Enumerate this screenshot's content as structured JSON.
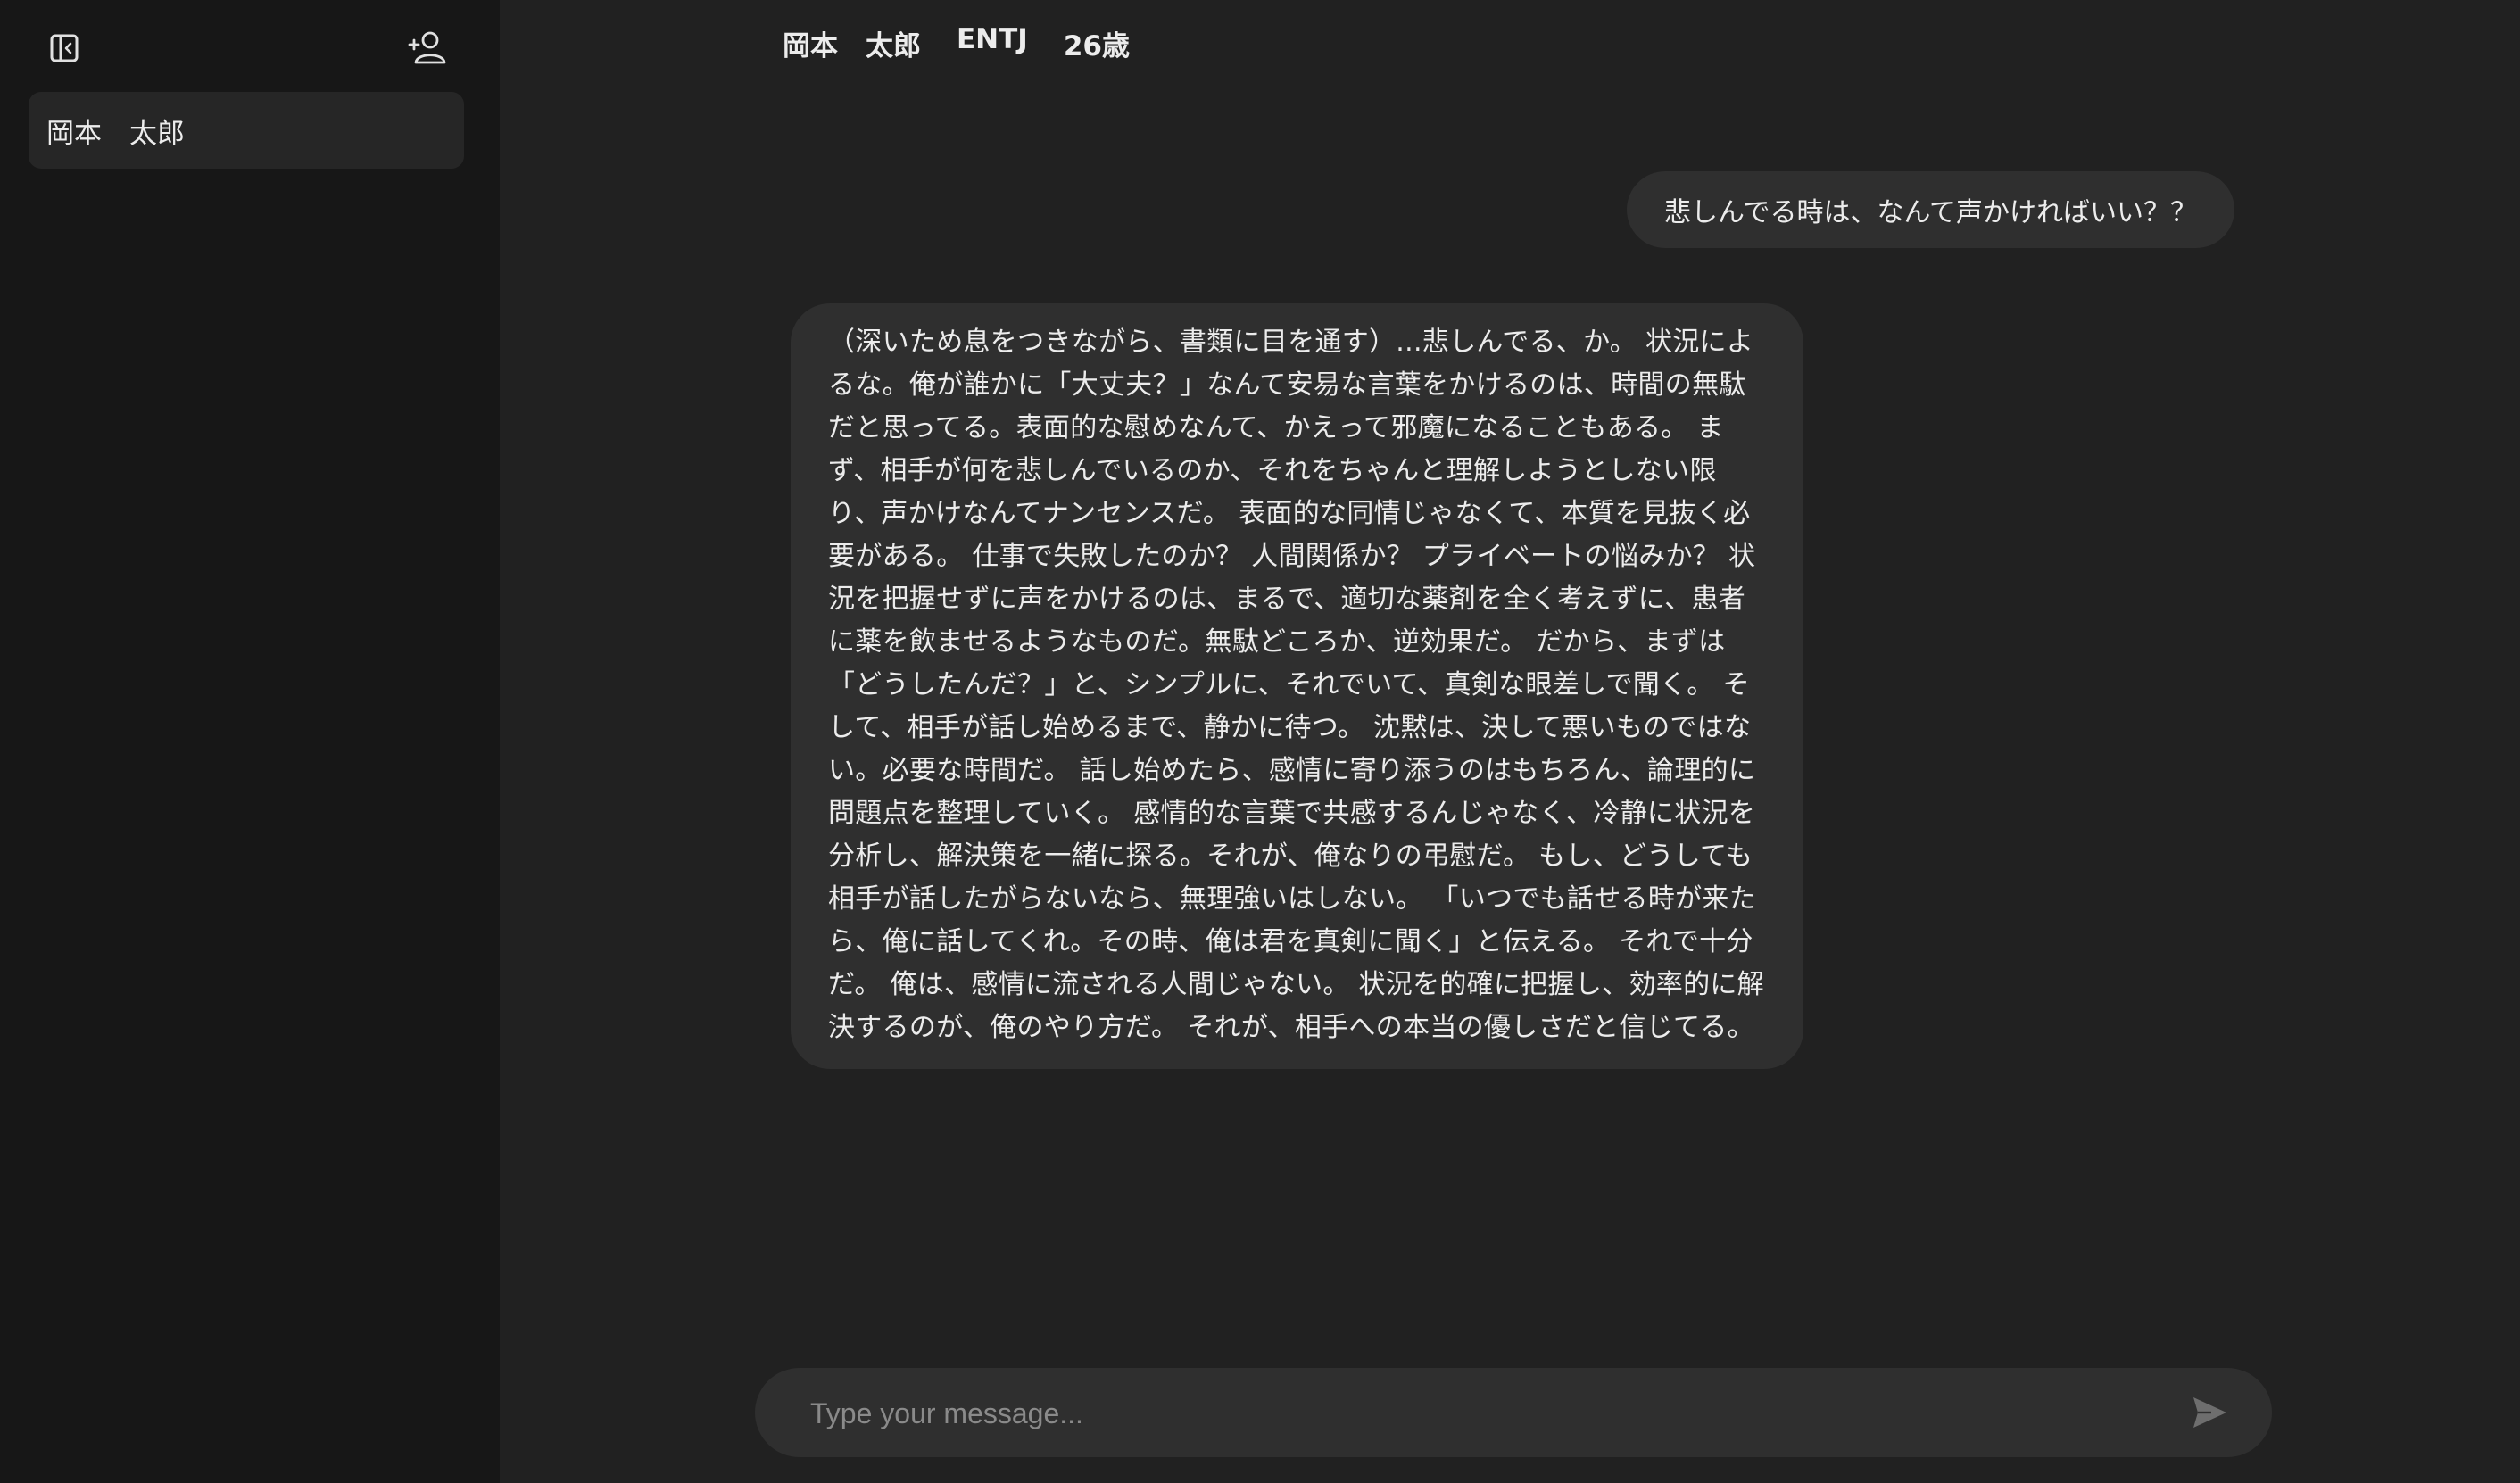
{
  "sidebar": {
    "toggle_icon": "sidebar-panel-icon",
    "new_persona_icon": "add-user-icon",
    "items": [
      {
        "label": "岡本　太郎"
      }
    ]
  },
  "header": {
    "name": "岡本　太郎",
    "mbti": "ENTJ",
    "age": "26歳"
  },
  "messages": [
    {
      "role": "user",
      "text": "悲しんでる時は、なんて声かければいい？？"
    },
    {
      "role": "assistant",
      "text": "（深いため息をつきながら、書類に目を通す）...悲しんでる、か。 状況によるな。俺が誰かに「大丈夫？」なんて安易な言葉をかけるのは、時間の無駄だと思ってる。表面的な慰めなんて、かえって邪魔になることもある。 まず、相手が何を悲しんでいるのか、それをちゃんと理解しようとしない限り、声かけなんてナンセンスだ。 表面的な同情じゃなくて、本質を見抜く必要がある。 仕事で失敗したのか？ 人間関係か？ プライベートの悩みか？ 状況を把握せずに声をかけるのは、まるで、適切な薬剤を全く考えずに、患者に薬を飲ませるようなものだ。無駄どころか、逆効果だ。 だから、まずは「どうしたんだ？」と、シンプルに、それでいて、真剣な眼差しで聞く。 そして、相手が話し始めるまで、静かに待つ。 沈黙は、決して悪いものではない。必要な時間だ。 話し始めたら、感情に寄り添うのはもちろん、論理的に問題点を整理していく。 感情的な言葉で共感するんじゃなく、冷静に状況を分析し、解決策を一緒に探る。それが、俺なりの弔慰だ。 もし、どうしても相手が話したがらないなら、無理強いはしない。 「いつでも話せる時が来たら、俺に話してくれ。その時、俺は君を真剣に聞く」と伝える。 それで十分だ。 俺は、感情に流される人間じゃない。 状況を的確に把握し、効率的に解決するのが、俺のやり方だ。 それが、相手への本当の優しさだと信じてる。"
    }
  ],
  "composer": {
    "placeholder": "Type your message...",
    "value": "",
    "send_icon": "send-icon"
  },
  "colors": {
    "sidebar_bg": "#171717",
    "main_bg": "#212121",
    "bubble_bg": "#2f2f2f",
    "text": "#ececec",
    "placeholder": "#8a8a8a"
  }
}
